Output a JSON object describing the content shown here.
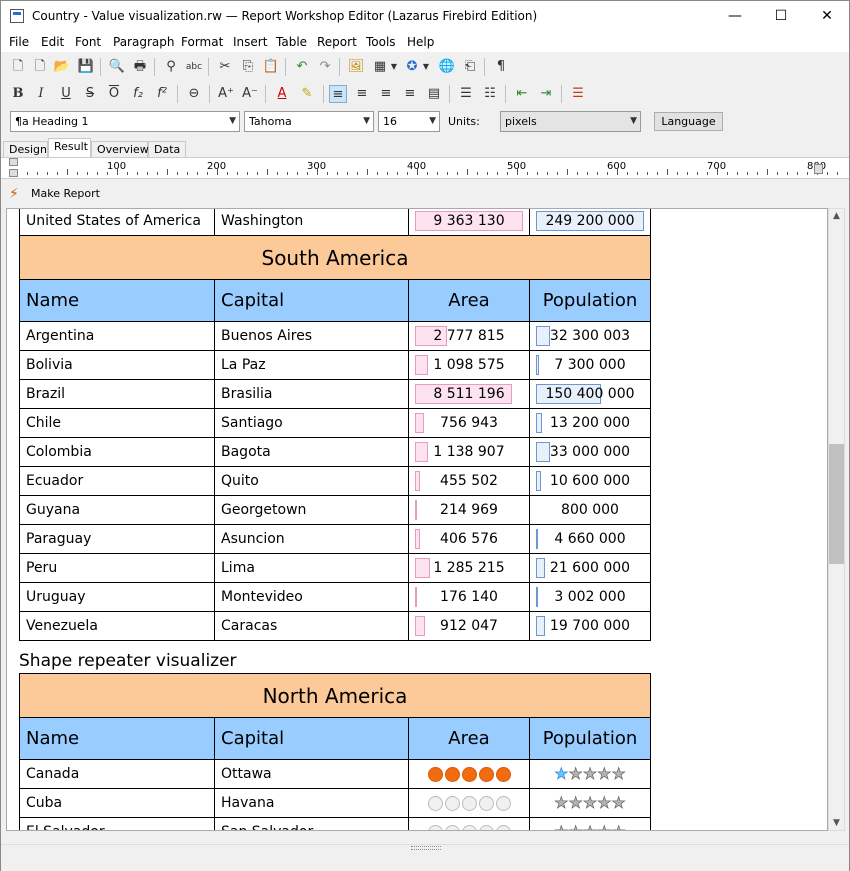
{
  "window": {
    "title": "Country - Value visualization.rw — Report Workshop Editor (Lazarus Firebird Edition)",
    "min": "—",
    "max": "☐",
    "close": "✕"
  },
  "menu": [
    "File",
    "Edit",
    "Font",
    "Paragraph",
    "Format",
    "Insert",
    "Table",
    "Report",
    "Tools",
    "Help"
  ],
  "format_bar": {
    "style": "Heading 1",
    "font": "Tahoma",
    "size": "16",
    "units_label": "Units:",
    "units": "pixels",
    "language_button": "Language"
  },
  "tabs": [
    "Design",
    "Result",
    "Overview",
    "Data"
  ],
  "active_tab": "Result",
  "ruler": [
    "100",
    "200",
    "300",
    "400",
    "500",
    "600",
    "700",
    "800"
  ],
  "make_report": "Make Report",
  "accent": {
    "region": "#fcca99",
    "header": "#99ccff",
    "area_bar": "#fde3ef",
    "pop_bar": "#e8f0fb",
    "circle": "#f26b0f",
    "star": "#66c3ff"
  },
  "top_row": {
    "name": "United States of America",
    "capital": "Washington",
    "area": "9 363 130",
    "population": "249 200 000"
  },
  "table1": {
    "region": "South America",
    "headers": {
      "name": "Name",
      "capital": "Capital",
      "area": "Area",
      "population": "Population"
    },
    "rows": [
      {
        "name": "Argentina",
        "capital": "Buenos Aires",
        "area": "2 777 815",
        "population": "32 300 003",
        "area_frac": 0.326,
        "pop_frac": 0.13
      },
      {
        "name": "Bolivia",
        "capital": "La Paz",
        "area": "1 098 575",
        "population": "7 300 000",
        "area_frac": 0.129,
        "pop_frac": 0.029
      },
      {
        "name": "Brazil",
        "capital": "Brasilia",
        "area": "8 511 196",
        "population": "150 400 000",
        "area_frac": 1.0,
        "pop_frac": 0.604
      },
      {
        "name": "Chile",
        "capital": "Santiago",
        "area": "756 943",
        "population": "13 200 000",
        "area_frac": 0.089,
        "pop_frac": 0.053
      },
      {
        "name": "Colombia",
        "capital": "Bagota",
        "area": "1 138 907",
        "population": "33 000 000",
        "area_frac": 0.134,
        "pop_frac": 0.132
      },
      {
        "name": "Ecuador",
        "capital": "Quito",
        "area": "455 502",
        "population": "10 600 000",
        "area_frac": 0.054,
        "pop_frac": 0.043
      },
      {
        "name": "Guyana",
        "capital": "Georgetown",
        "area": "214 969",
        "population": "800 000",
        "area_frac": 0.025,
        "pop_frac": 0.003
      },
      {
        "name": "Paraguay",
        "capital": "Asuncion",
        "area": "406 576",
        "population": "4 660 000",
        "area_frac": 0.048,
        "pop_frac": 0.019
      },
      {
        "name": "Peru",
        "capital": "Lima",
        "area": "1 285 215",
        "population": "21 600 000",
        "area_frac": 0.151,
        "pop_frac": 0.087
      },
      {
        "name": "Uruguay",
        "capital": "Montevideo",
        "area": "176 140",
        "population": "3 002 000",
        "area_frac": 0.021,
        "pop_frac": 0.012
      },
      {
        "name": "Venezuela",
        "capital": "Caracas",
        "area": "912 047",
        "population": "19 700 000",
        "area_frac": 0.107,
        "pop_frac": 0.079
      }
    ]
  },
  "section_title": "Shape repeater visualizer",
  "table2": {
    "region": "North America",
    "headers": {
      "name": "Name",
      "capital": "Capital",
      "area": "Area",
      "population": "Population"
    },
    "rows": [
      {
        "name": "Canada",
        "capital": "Ottawa",
        "area_circles": 5,
        "pop_stars": 1
      },
      {
        "name": "Cuba",
        "capital": "Havana",
        "area_circles": 0,
        "pop_stars": 0
      },
      {
        "name": "El Salvador",
        "capital": "San Salvador",
        "area_circles": 0,
        "pop_stars": 0
      }
    ],
    "circle_total": 5,
    "star_total": 5
  }
}
